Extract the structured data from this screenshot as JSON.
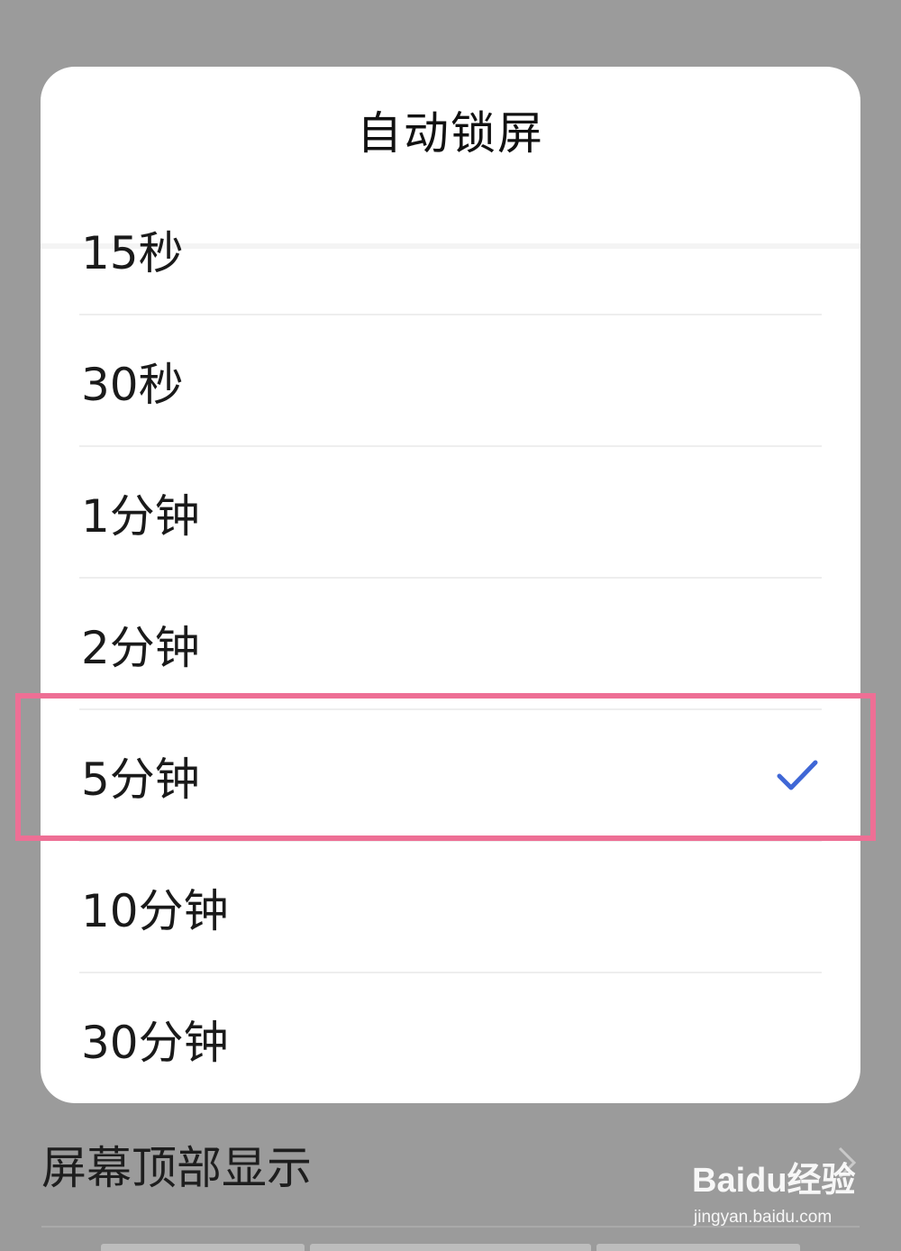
{
  "dialog": {
    "title": "自动锁屏",
    "options": [
      {
        "label": "15秒",
        "selected": false
      },
      {
        "label": "30秒",
        "selected": false
      },
      {
        "label": "1分钟",
        "selected": false
      },
      {
        "label": "2分钟",
        "selected": false
      },
      {
        "label": "5分钟",
        "selected": true
      },
      {
        "label": "10分钟",
        "selected": false
      },
      {
        "label": "30分钟",
        "selected": false
      }
    ],
    "selected_icon": "checkmark-icon",
    "accent_color": "#3f67d6"
  },
  "background": {
    "row_label": "屏幕顶部显示",
    "row_icon": "chevron-right-icon"
  },
  "annotation": {
    "highlight_color": "#ee6f95"
  },
  "watermark": {
    "logo": "Baidu经验",
    "url": "jingyan.baidu.com"
  }
}
